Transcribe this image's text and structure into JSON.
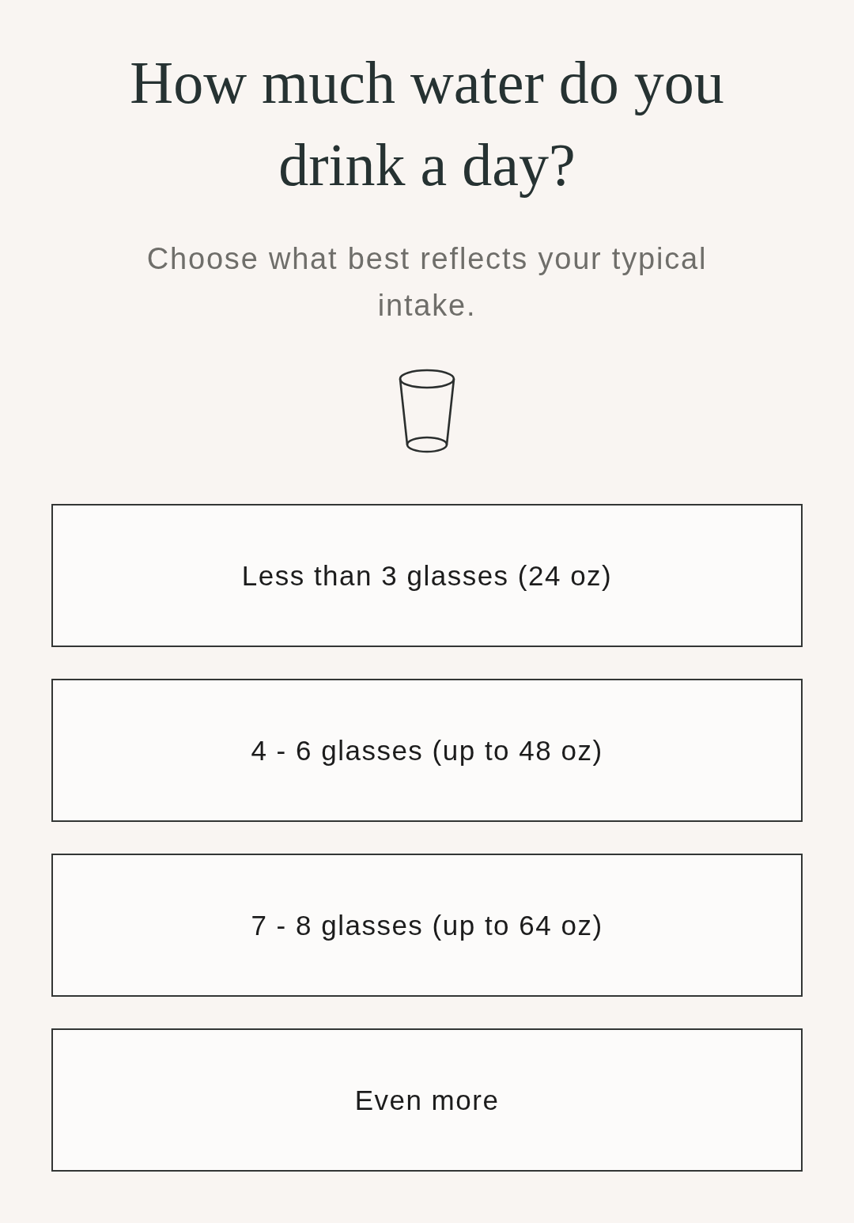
{
  "question": {
    "title": "How much water do you drink a day?",
    "subtitle": "Choose what best reflects your typical intake."
  },
  "options": [
    {
      "label": "Less than 3 glasses (24 oz)",
      "selected": false
    },
    {
      "label": "4 - 6 glasses (up to 48 oz)",
      "selected": false
    },
    {
      "label": "7 - 8 glasses (up to 64 oz)",
      "selected": false
    },
    {
      "label": "Even more",
      "selected": false
    }
  ]
}
